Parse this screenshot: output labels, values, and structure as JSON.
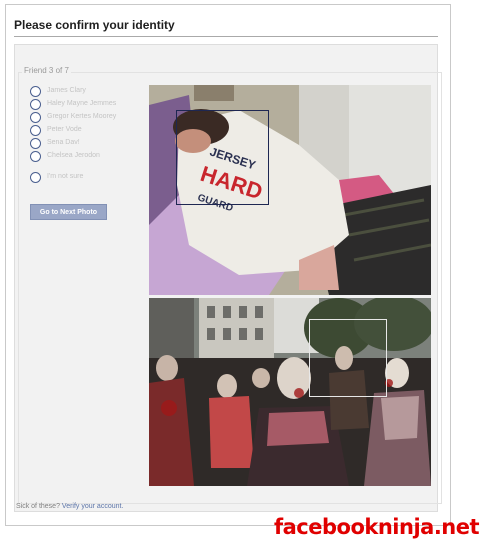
{
  "dialog": {
    "title": "Please confirm your identity"
  },
  "panel": {
    "friend_counter": "Friend 3 of 7",
    "options": [
      {
        "label": "James Clary"
      },
      {
        "label": "Haley Mayne Jemmes"
      },
      {
        "label": "Gregor Kertes Moorey"
      },
      {
        "label": "Peter Vode"
      },
      {
        "label": "Sena Dav!"
      },
      {
        "label": "Chelsea Jerodon"
      },
      {
        "label": "I'm not sure"
      }
    ],
    "next_button_label": "Go to Next Photo"
  },
  "photos": [
    {
      "subject": "person-sleeping-on-bed",
      "shirt_text": "JERSEY HARD GUARD"
    },
    {
      "subject": "zombie-walk-crowd"
    }
  ],
  "footer": {
    "prefix": "Sick of these?",
    "link_label": "Verify your account."
  },
  "watermark": "facebookninja.net",
  "colors": {
    "title_text": "#1f1f1f",
    "panel_bg": "#f2f2f2",
    "radio_border": "#4a5f8f",
    "button_bg": "#9aa7c7",
    "link": "#5b74a8",
    "watermark": "#e00000"
  }
}
